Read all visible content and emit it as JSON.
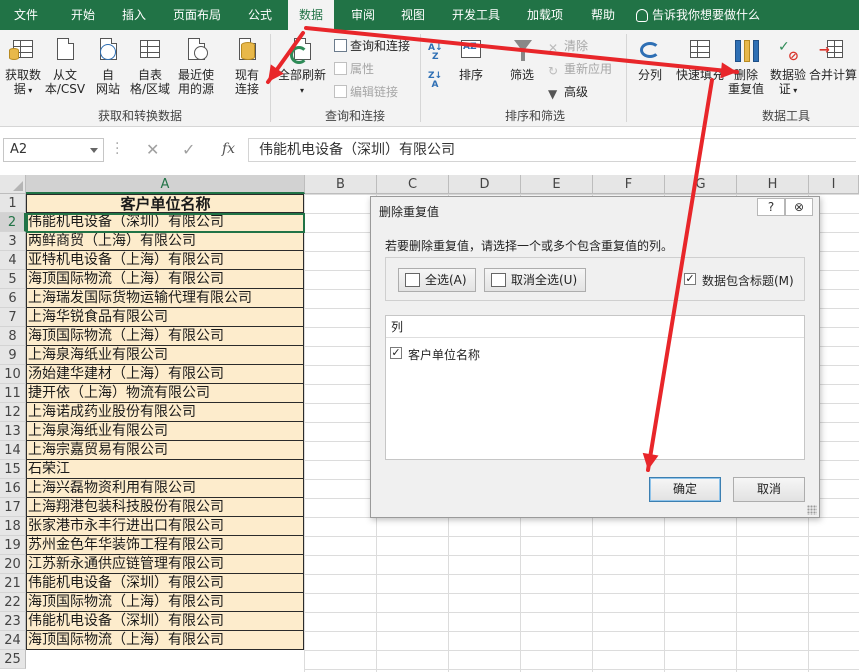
{
  "ribbon": {
    "tabs": [
      {
        "label": "文件",
        "name": "tab-file"
      },
      {
        "label": "开始",
        "name": "tab-home"
      },
      {
        "label": "插入",
        "name": "tab-insert"
      },
      {
        "label": "页面布局",
        "name": "tab-page-layout"
      },
      {
        "label": "公式",
        "name": "tab-formulas"
      },
      {
        "label": "数据",
        "name": "tab-data"
      },
      {
        "label": "审阅",
        "name": "tab-review"
      },
      {
        "label": "视图",
        "name": "tab-view"
      },
      {
        "label": "开发工具",
        "name": "tab-developer"
      },
      {
        "label": "加载项",
        "name": "tab-addins"
      },
      {
        "label": "帮助",
        "name": "tab-help"
      },
      {
        "label": "告诉我你想要做什么",
        "name": "tell-me-search"
      }
    ],
    "active_tab": "数据",
    "groups": {
      "get_transform": {
        "label": "获取和转换数据",
        "buttons": {
          "get_data": [
            "获取数",
            "据"
          ],
          "from_text": [
            "从文",
            "本/CSV"
          ],
          "from_web": [
            "自",
            "网站"
          ],
          "from_table": [
            "自表",
            "格/区域"
          ],
          "recent_sources": [
            "最近使",
            "用的源"
          ],
          "existing": [
            "现有",
            "连接"
          ]
        }
      },
      "queries": {
        "label": "查询和连接",
        "refresh_all": "全部刷新",
        "queries_connections": "查询和连接",
        "properties": "属性",
        "edit_links": "编辑链接"
      },
      "sort_filter": {
        "label": "排序和筛选",
        "sort": "排序",
        "filter": "筛选",
        "clear": "清除",
        "reapply": "重新应用",
        "advanced": "高级"
      },
      "data_tools": {
        "label": "数据工具",
        "text_to_columns": "分列",
        "flash_fill": "快速填充",
        "remove_duplicates": [
          "删除",
          "重复值"
        ],
        "data_validation": [
          "数据验",
          "证"
        ],
        "consolidate": "合并计算"
      }
    }
  },
  "formula_bar": {
    "name_box": "A2",
    "cancel": "✕",
    "enter": "✓",
    "fx": "fx",
    "content": "伟能机电设备（深圳）有限公司"
  },
  "sheet": {
    "columns": [
      "A",
      "B",
      "C",
      "D",
      "E",
      "F",
      "G",
      "H",
      "I"
    ],
    "row_numbers": [
      "1",
      "2",
      "3",
      "4",
      "5",
      "6",
      "7",
      "8",
      "9",
      "10",
      "11",
      "12",
      "13",
      "14",
      "15",
      "16",
      "17",
      "18",
      "19",
      "20",
      "21",
      "22",
      "23",
      "24",
      "25"
    ],
    "header": "客户单位名称",
    "rows": [
      "伟能机电设备（深圳）有限公司",
      "两鲜商贸（上海）有限公司",
      "亚特机电设备（上海）有限公司",
      "海顶国际物流（上海）有限公司",
      "上海瑞发国际货物运输代理有限公司",
      "上海华锐食品有限公司",
      "海顶国际物流（上海）有限公司",
      "上海泉海纸业有限公司",
      "汤始建华建材（上海）有限公司",
      "捷开依（上海）物流有限公司",
      "上海诺成药业股份有限公司",
      "上海泉海纸业有限公司",
      "上海宗嘉贸易有限公司",
      "石荣江",
      "上海兴磊物资利用有限公司",
      "上海翔港包装科技股份有限公司",
      "张家港市永丰行进出口有限公司",
      "苏州金色年华装饰工程有限公司",
      "江苏新永通供应链管理有限公司",
      "伟能机电设备（深圳）有限公司",
      "海顶国际物流（上海）有限公司",
      "伟能机电设备（深圳）有限公司",
      "海顶国际物流（上海）有限公司"
    ]
  },
  "dialog": {
    "title": "删除重复值",
    "help": "?",
    "close": "⊗",
    "instruction": "若要删除重复值，请选择一个或多个包含重复值的列。",
    "select_all": "全选(A)",
    "unselect_all": "取消全选(U)",
    "has_headers_label": "数据包含标题(M)",
    "has_headers_checked": true,
    "list_header": "列",
    "columns": [
      {
        "label": "客户单位名称",
        "checked": true
      }
    ],
    "ok": "确定",
    "cancel": "取消"
  },
  "colors": {
    "ribbon_green": "#217346",
    "cell_fill": "#fdeccc",
    "annotation_arrow": "#e8262a"
  }
}
